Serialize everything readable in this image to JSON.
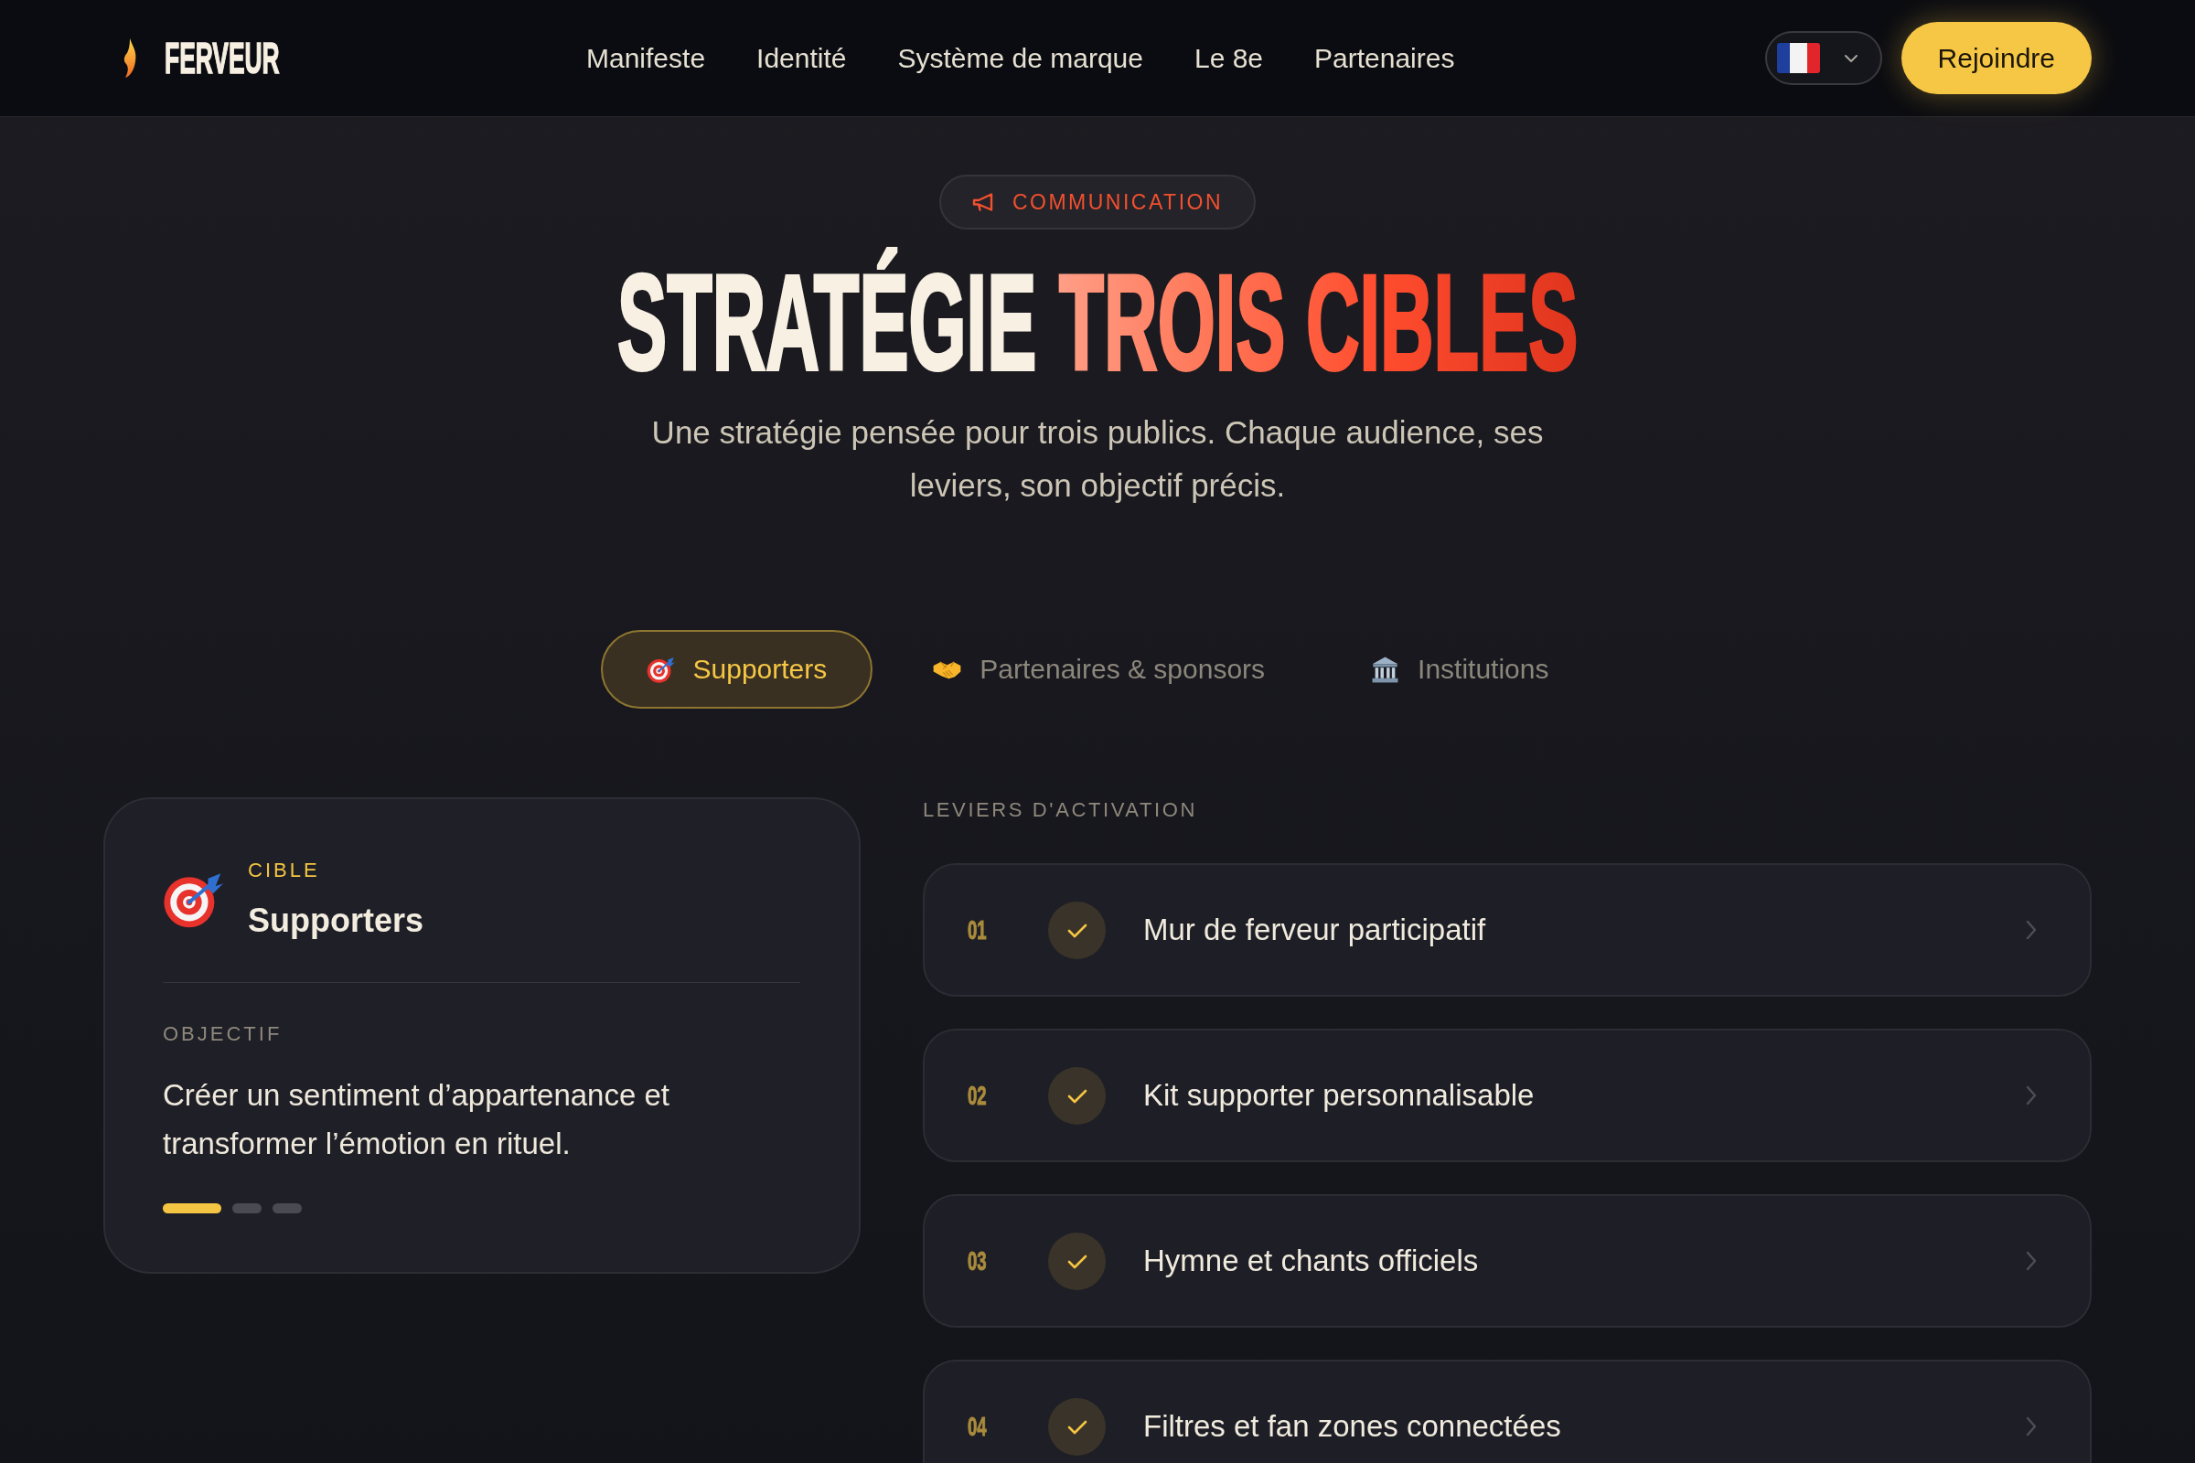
{
  "nav": {
    "brand": "FERVEUR",
    "links": [
      "Manifeste",
      "Identité",
      "Système de marque",
      "Le 8e",
      "Partenaires"
    ],
    "cta": "Rejoindre"
  },
  "hero": {
    "badge": "COMMUNICATION",
    "title": "STRATÉGIE",
    "title_accent": "TROIS CIBLES",
    "subtitle": "Une stratégie pensée pour trois publics. Chaque audience, ses leviers, son objectif précis."
  },
  "tabs": [
    {
      "label": "Supporters",
      "kind": "target",
      "selected": true
    },
    {
      "label": "Partenaires & sponsors",
      "kind": "handshake",
      "selected": false
    },
    {
      "label": "Institutions",
      "kind": "building",
      "selected": false
    }
  ],
  "target_card": {
    "eyebrow": "CIBLE",
    "name": "Supporters",
    "objective_label": "OBJECTIF",
    "objective": "Créer un sentiment d’appartenance et transformer l’émotion en rituel.",
    "dots": [
      {
        "selected": true
      },
      {
        "selected": false
      },
      {
        "selected": false
      }
    ]
  },
  "levers": {
    "heading": "LEVIERS D'ACTIVATION",
    "items": [
      {
        "number": "01",
        "label": "Mur de ferveur participatif",
        "checked": true
      },
      {
        "number": "02",
        "label": "Kit supporter personnalisable",
        "checked": true
      },
      {
        "number": "03",
        "label": "Hymne et chants officiels",
        "checked": true
      },
      {
        "number": "04",
        "label": "Filtres et fan zones connectées",
        "checked": true
      }
    ]
  }
}
